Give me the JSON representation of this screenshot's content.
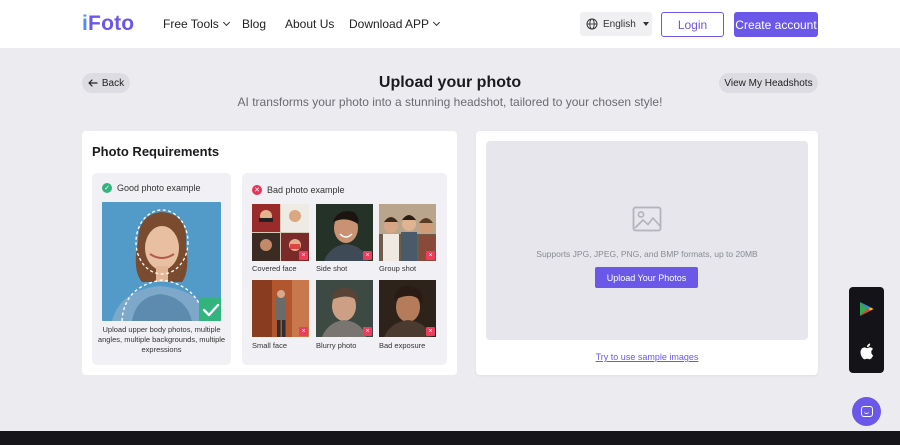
{
  "nav": {
    "logo": "iFoto",
    "logo_first": "i",
    "logo_rest": "Foto",
    "links": [
      {
        "label": "Free Tools",
        "has_dropdown": true
      },
      {
        "label": "Blog",
        "has_dropdown": false
      },
      {
        "label": "About Us",
        "has_dropdown": false
      },
      {
        "label": "Download APP",
        "has_dropdown": true
      }
    ],
    "language": "English",
    "login": "Login",
    "create_account": "Create account"
  },
  "header": {
    "back": "Back",
    "title": "Upload your photo",
    "subtitle": "AI transforms your photo into a stunning headshot, tailored to your chosen style!",
    "view_headshots": "View My Headshots"
  },
  "requirements": {
    "title": "Photo Requirements",
    "good": {
      "label": "Good photo example",
      "caption": "Upload upper body photos, multiple angles, multiple backgrounds, multiple expressions"
    },
    "bad": {
      "label": "Bad photo example",
      "items": [
        {
          "label": "Covered face"
        },
        {
          "label": "Side shot"
        },
        {
          "label": "Group shot"
        },
        {
          "label": "Small face"
        },
        {
          "label": "Blurry photo"
        },
        {
          "label": "Bad exposure"
        }
      ]
    }
  },
  "upload": {
    "formats": "Supports JPG, JPEG, PNG, and BMP formats, up to 20MB",
    "button": "Upload Your Photos",
    "sample_link": "Try to use sample images"
  },
  "colors": {
    "accent": "#6b57e8",
    "good": "#33b47d",
    "bad": "#e6355a"
  },
  "icons": {
    "side_panel": [
      "google-play-icon",
      "apple-icon"
    ],
    "chat": "chat-icon"
  }
}
